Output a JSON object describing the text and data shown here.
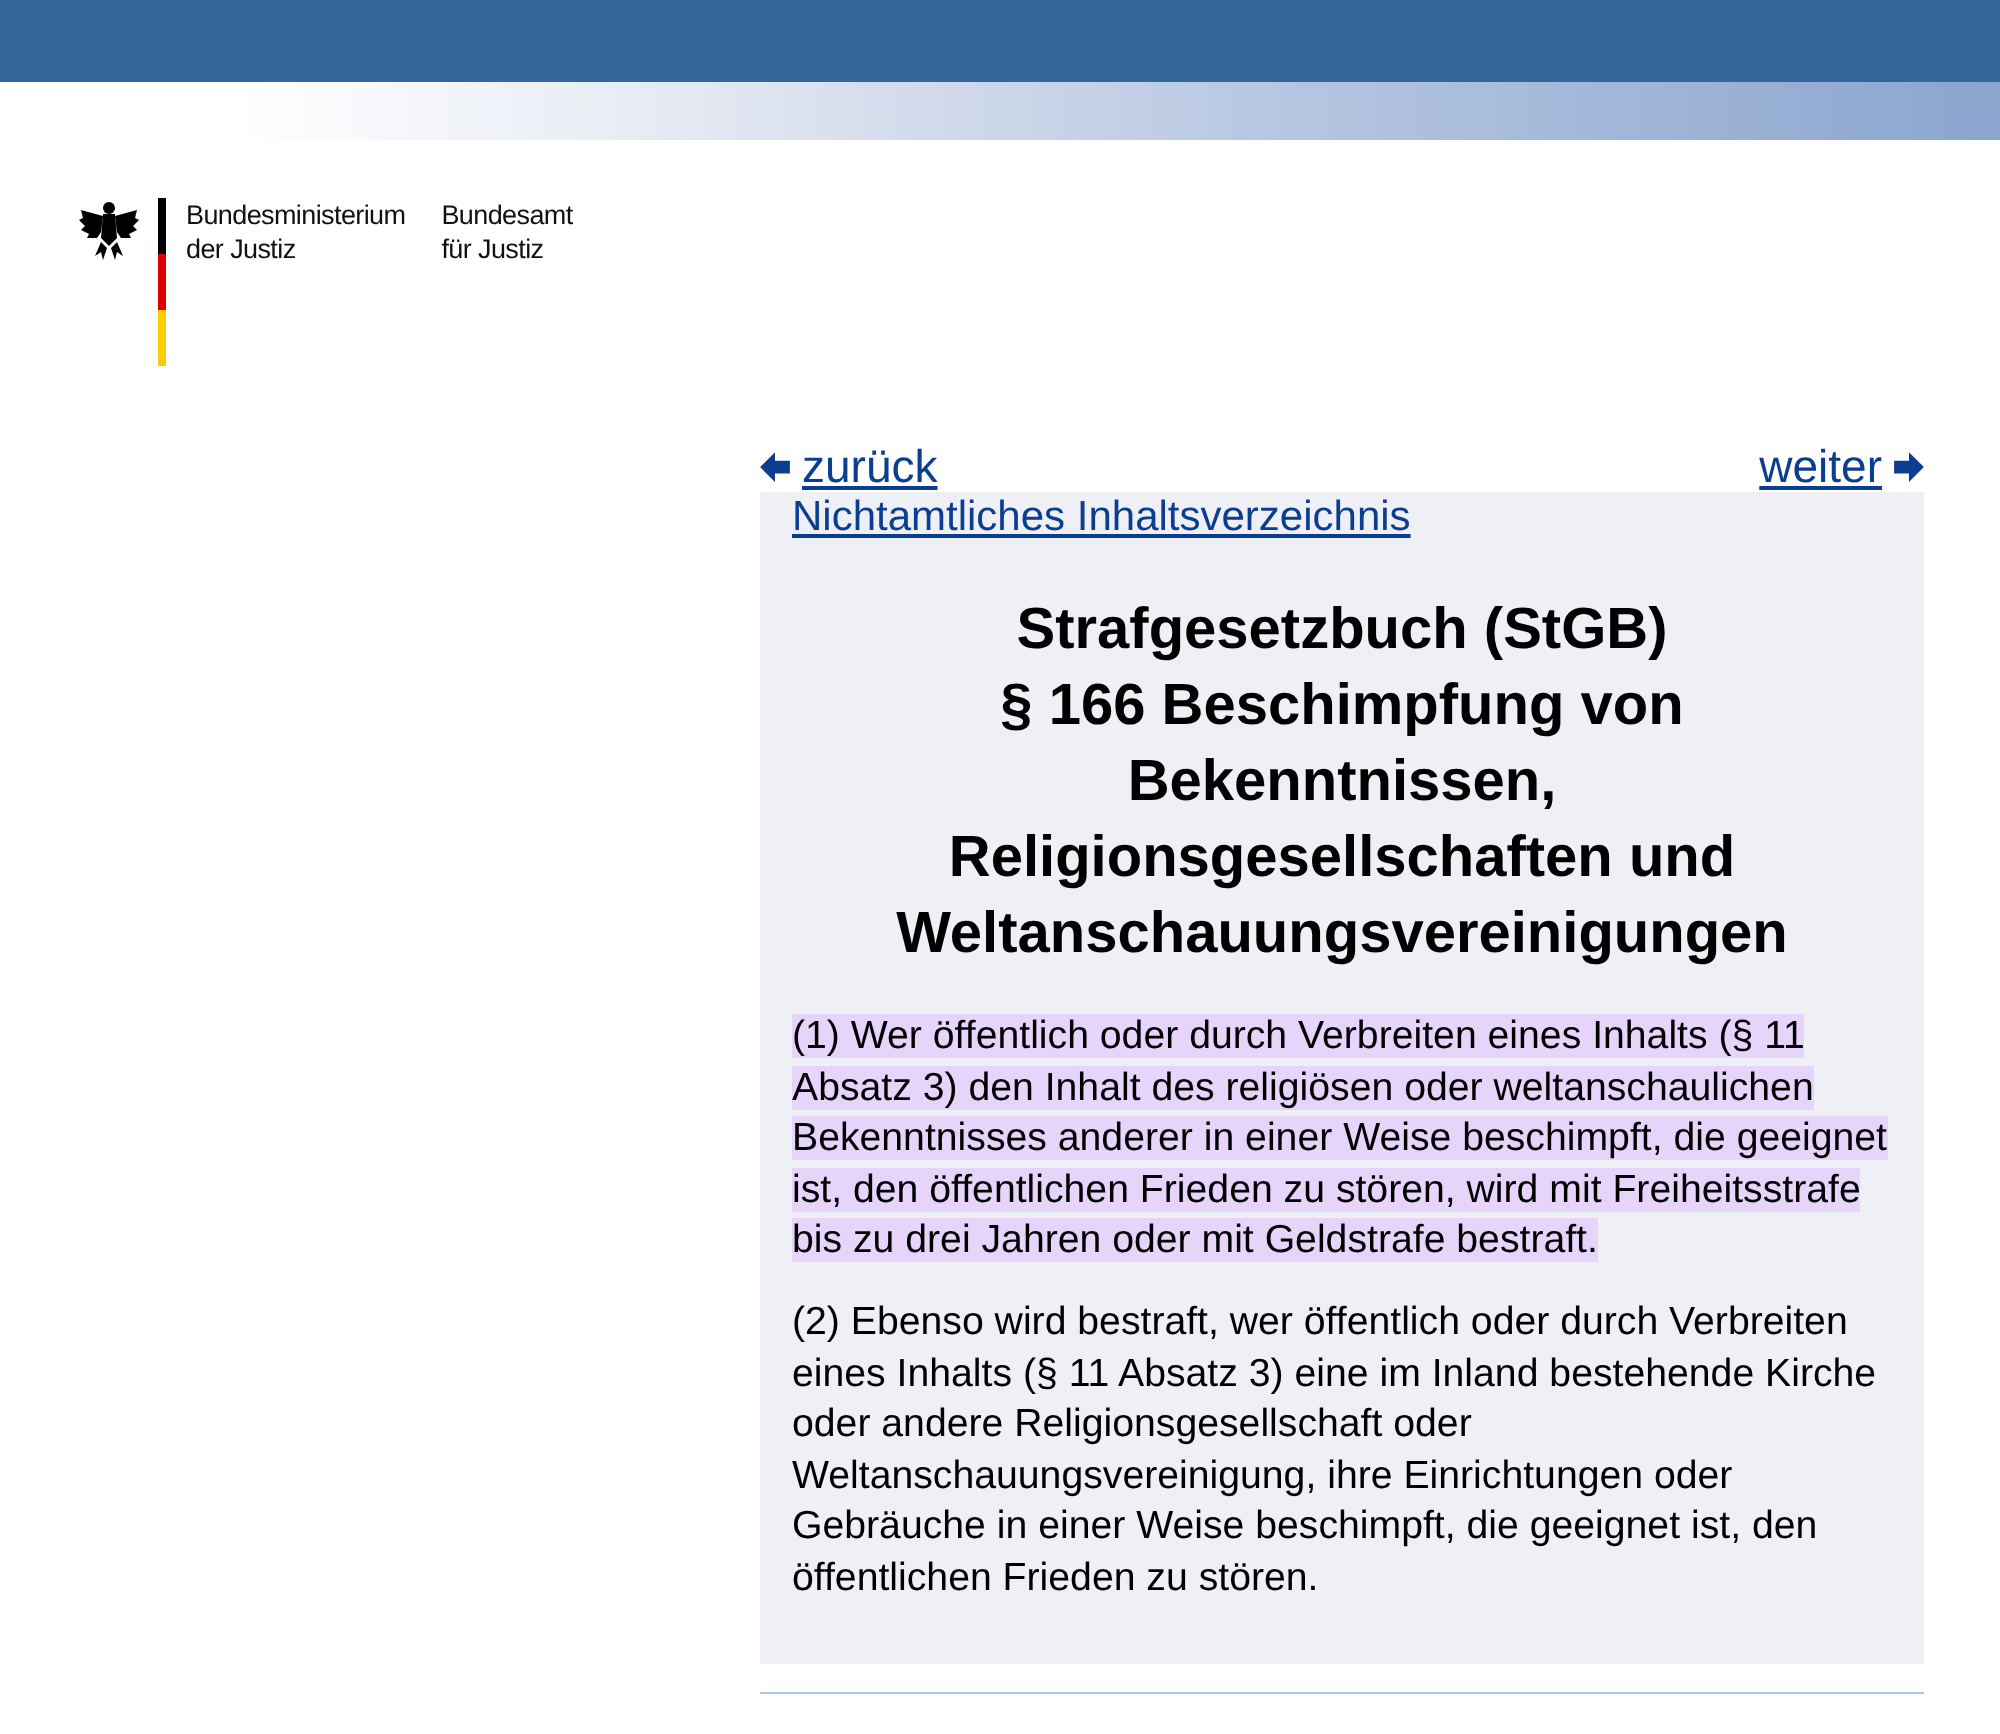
{
  "logo": {
    "ministry": [
      "Bundesministerium",
      "der Justiz"
    ],
    "office": [
      "Bundesamt",
      "für Justiz"
    ]
  },
  "nav": {
    "back": "zurück",
    "next": "weiter",
    "toc": "Nichtamtliches Inhaltsverzeichnis"
  },
  "title": [
    "Strafgesetzbuch (StGB)",
    "§ 166 Beschimpfung von Bekenntnissen, Religionsgesellschaften und Weltanschauungsvereinigungen"
  ],
  "paragraphs": [
    {
      "text": "(1) Wer öffentlich oder durch Verbreiten eines Inhalts (§ 11 Absatz 3) den Inhalt des religiösen oder weltanschaulichen Bekenntnisses anderer in einer Weise beschimpft, die geeignet ist, den öffentlichen Frieden zu stören, wird mit Freiheitsstrafe bis zu drei Jahren oder mit Geldstrafe bestraft.",
      "highlighted": true
    },
    {
      "text": "(2) Ebenso wird bestraft, wer öffentlich oder durch Verbreiten eines Inhalts (§ 11 Absatz 3) eine im Inland bestehende Kirche oder andere Religionsgesellschaft oder Weltanschauungsvereinigung, ihre Einrichtungen oder Gebräuche in einer Weise beschimpft, die geeignet ist, den öffentlichen Frieden zu stören.",
      "highlighted": false
    }
  ]
}
